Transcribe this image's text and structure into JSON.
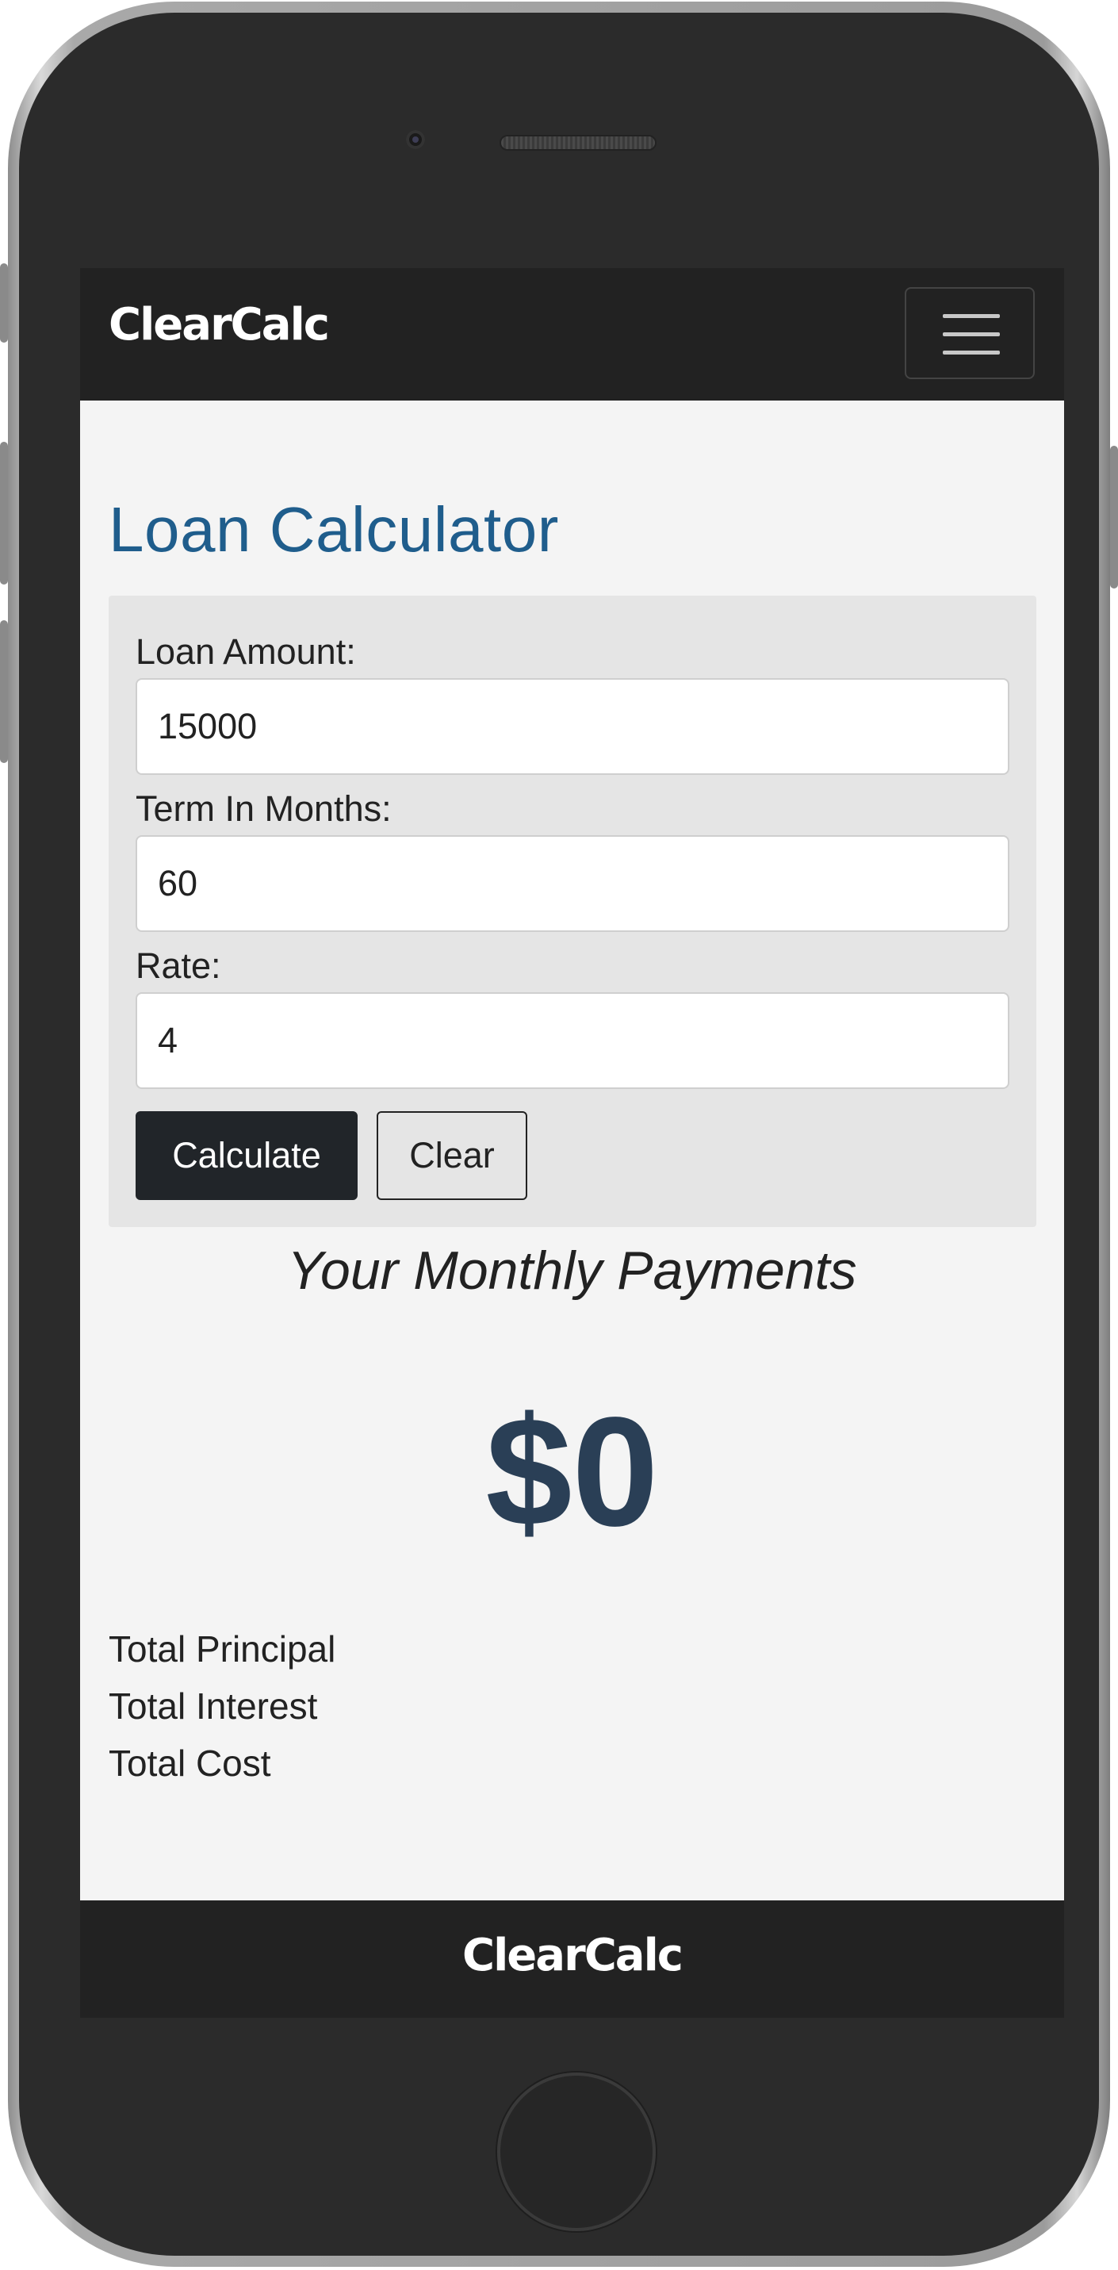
{
  "navbar": {
    "brand": "ClearCalc"
  },
  "main": {
    "title": "Loan Calculator",
    "form": {
      "loan_amount": {
        "label": "Loan Amount:",
        "value": "15000"
      },
      "term": {
        "label": "Term In Months:",
        "value": "60"
      },
      "rate": {
        "label": "Rate:",
        "value": "4"
      },
      "calculate_label": "Calculate",
      "clear_label": "Clear"
    },
    "results": {
      "heading": "Your Monthly Payments",
      "monthly_payment": "$0",
      "total_principal_label": "Total Principal",
      "total_interest_label": "Total Interest",
      "total_cost_label": "Total Cost"
    }
  },
  "footer": {
    "brand": "ClearCalc"
  },
  "icons": {
    "menu": "hamburger-menu-icon"
  },
  "colors": {
    "navbar_bg": "#222222",
    "title": "#1f5d8c",
    "payment_amount": "#2a3f56",
    "calculate_button_bg": "#212529",
    "page_bg": "#f4f4f4",
    "form_bg": "#e5e5e5"
  }
}
